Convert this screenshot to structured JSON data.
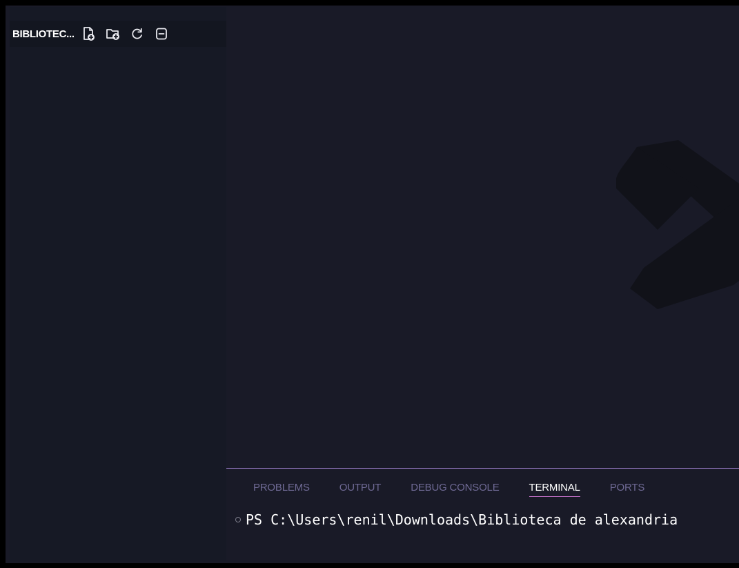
{
  "sidebar": {
    "title": "BIBLIOTEC...",
    "actions": [
      {
        "icon": "new-file-icon"
      },
      {
        "icon": "new-folder-icon"
      },
      {
        "icon": "refresh-icon"
      },
      {
        "icon": "collapse-all-icon"
      }
    ]
  },
  "editor": {
    "watermark_icon": "x-logo-watermark"
  },
  "panel": {
    "tabs": [
      {
        "label": "PROBLEMS",
        "active": false
      },
      {
        "label": "OUTPUT",
        "active": false
      },
      {
        "label": "DEBUG CONSOLE",
        "active": false
      },
      {
        "label": "TERMINAL",
        "active": true
      },
      {
        "label": "PORTS",
        "active": false
      }
    ],
    "terminal": {
      "prompt": "PS C:\\Users\\renil\\Downloads\\Biblioteca de alexandria"
    }
  },
  "colors": {
    "background": "#191a27",
    "sidebar": "#161925",
    "panel_border": "#9a7dc8",
    "active_tab_underline": "#c26fc7",
    "inactive_tab_text": "#6f6a95"
  }
}
